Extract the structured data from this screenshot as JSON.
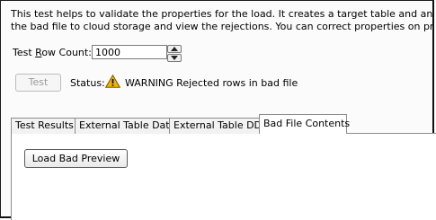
{
  "description": {
    "line1": "This test helps to validate the properties for the load.  It creates a target table and an external ta",
    "line2": "the bad file to cloud storage and view the rejections.  You can correct properties on previous page"
  },
  "row_count": {
    "label_prefix": "Test ",
    "label_mnemonic": "R",
    "label_suffix": "ow Count:",
    "value": "1000",
    "up_icon": "triangle-up-icon",
    "down_icon": "triangle-down-icon"
  },
  "test_button": {
    "label": "Test",
    "enabled": false
  },
  "status": {
    "label": "Status:",
    "icon": "warning-icon",
    "icon_color": "#f2b200",
    "text": "WARNING Rejected rows in bad file"
  },
  "tabs": [
    {
      "label": "Test Results"
    },
    {
      "label": "External Table Data"
    },
    {
      "label": "External Table DDL"
    },
    {
      "label": "Bad File Contents",
      "active": true
    }
  ],
  "panel": {
    "load_button_label": "Load Bad Preview"
  }
}
